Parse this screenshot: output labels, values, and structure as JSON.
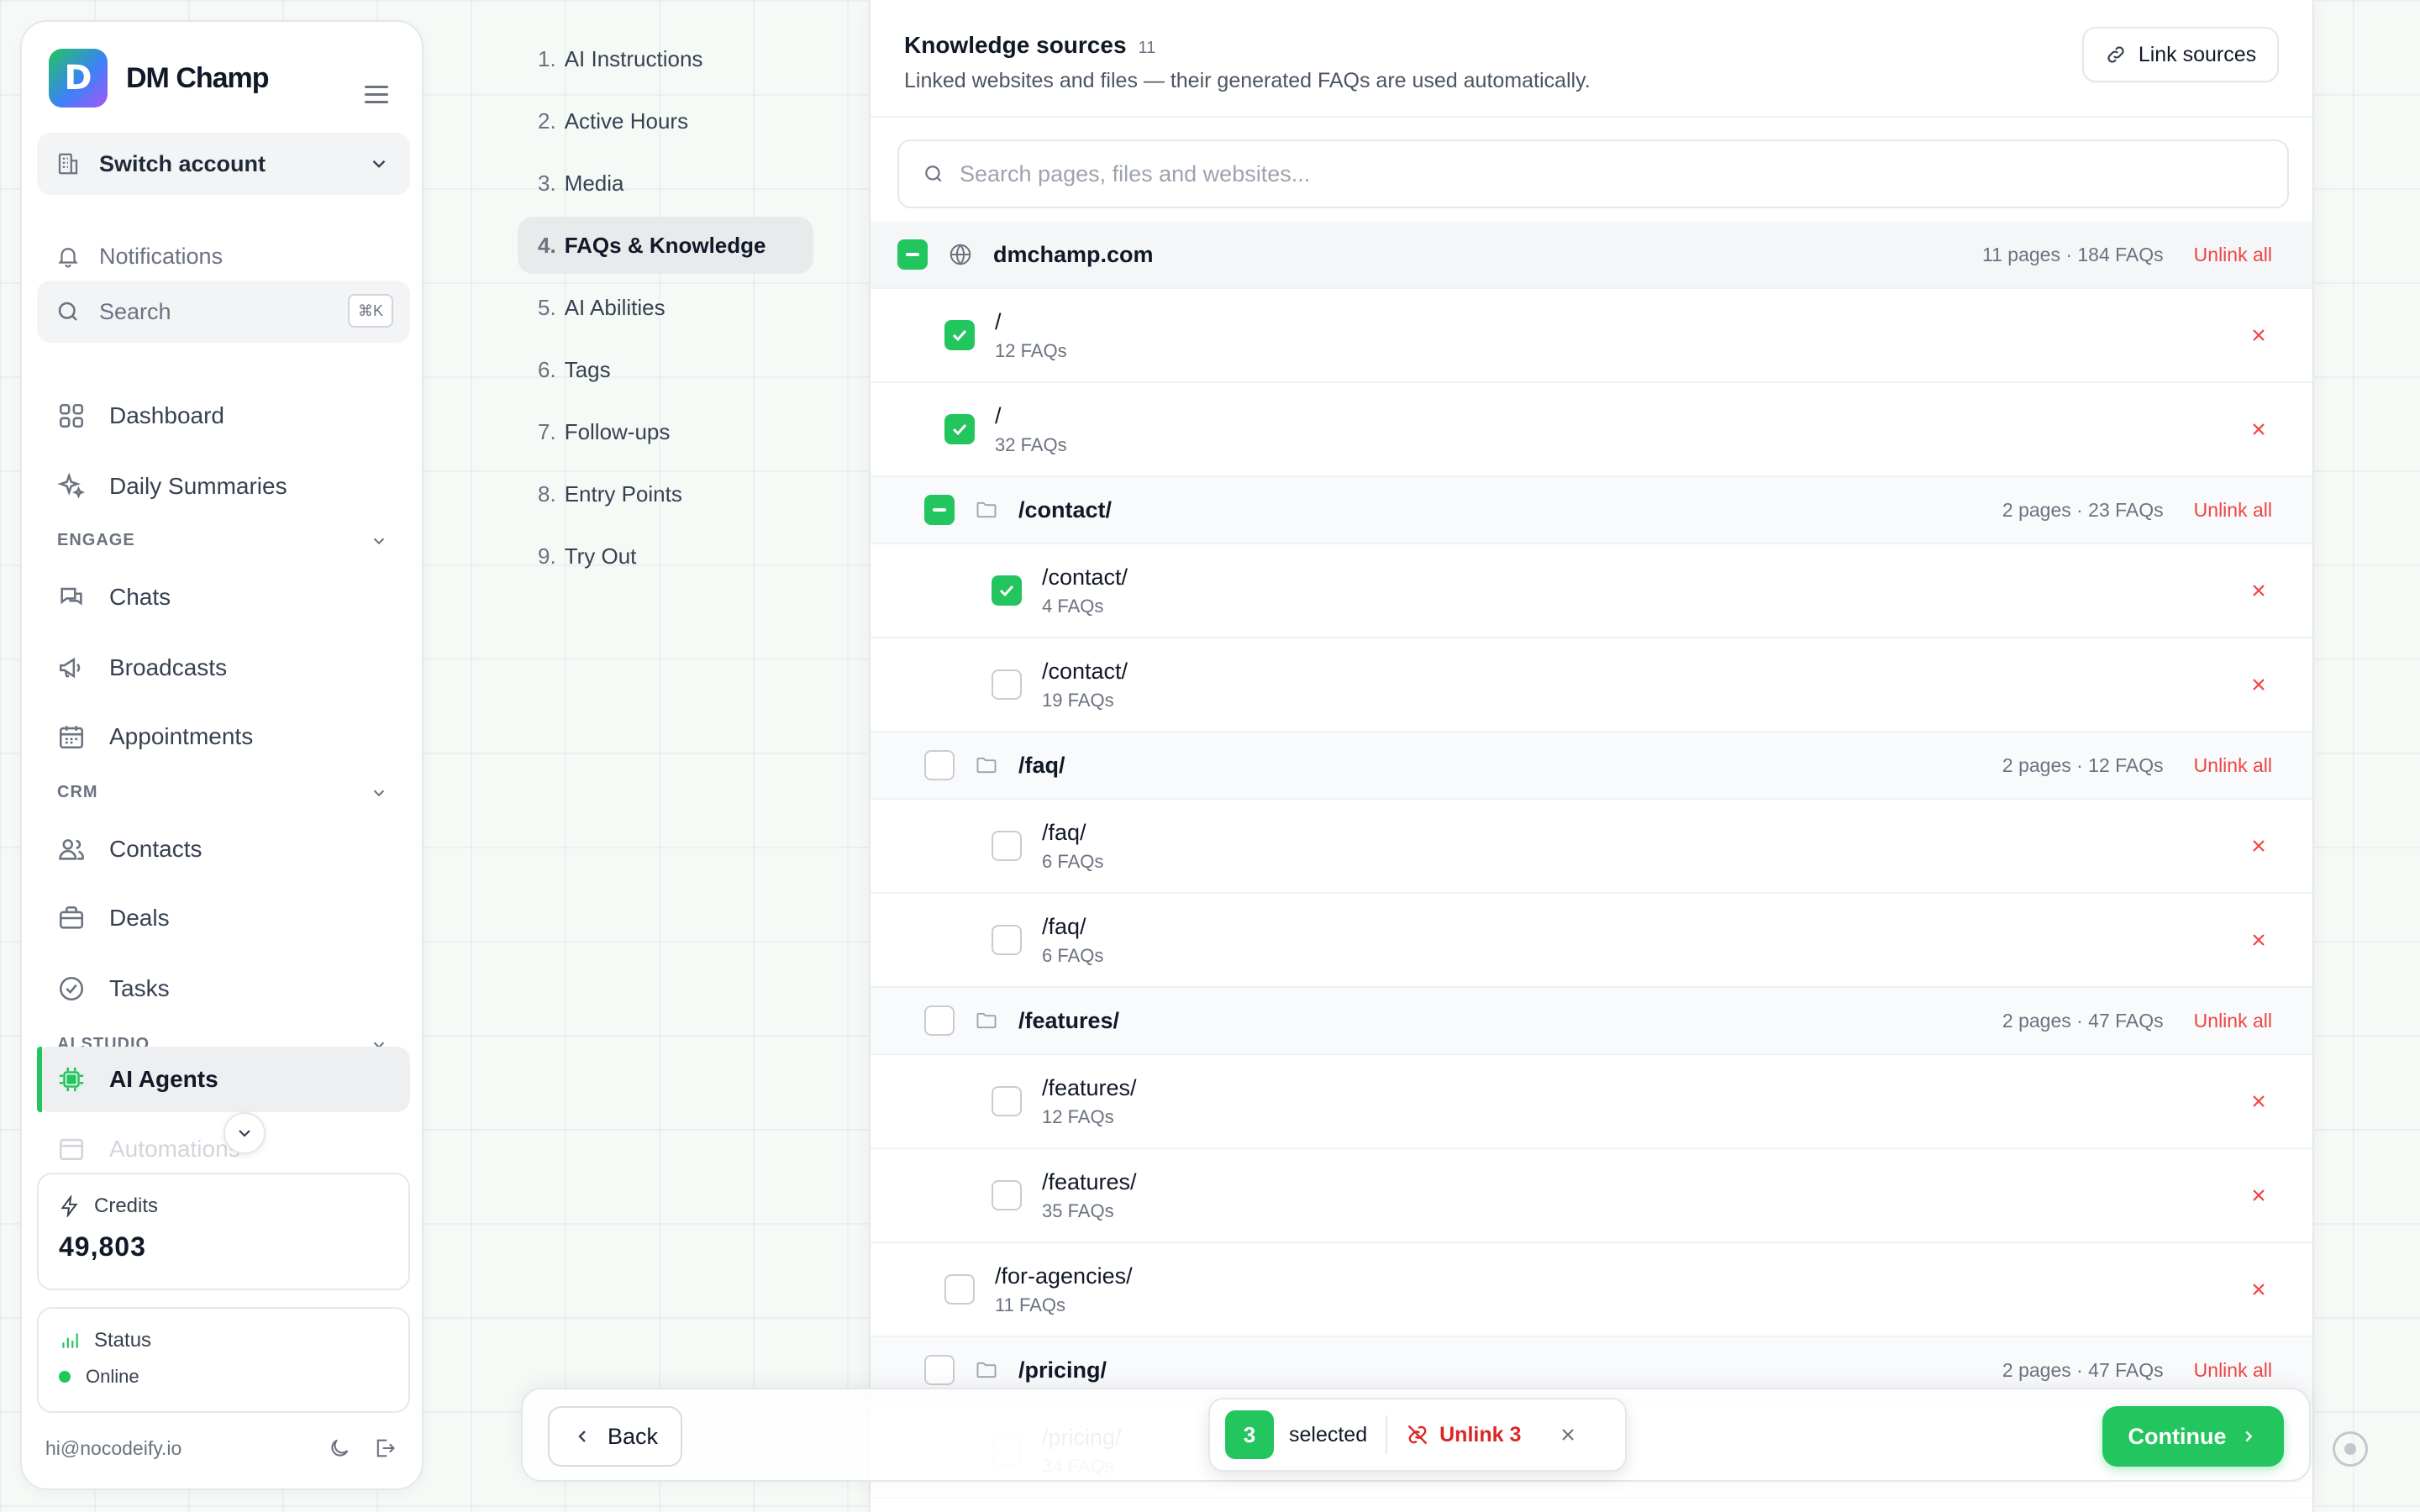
{
  "brand": {
    "name": "DM Champ",
    "logo_letter": "D"
  },
  "sidebar": {
    "switch_account": "Switch account",
    "notifications": "Notifications",
    "search_label": "Search",
    "search_kbd": "⌘K",
    "items_top": [
      {
        "label": "Dashboard",
        "icon": "grid-icon"
      },
      {
        "label": "Daily Summaries",
        "icon": "sparkles-icon"
      }
    ],
    "engage_header": "ENGAGE",
    "engage_items": [
      {
        "label": "Chats",
        "icon": "chat-icon"
      },
      {
        "label": "Broadcasts",
        "icon": "megaphone-icon"
      },
      {
        "label": "Appointments",
        "icon": "calendar-icon"
      }
    ],
    "crm_header": "CRM",
    "crm_items": [
      {
        "label": "Contacts",
        "icon": "users-icon"
      },
      {
        "label": "Deals",
        "icon": "briefcase-icon"
      },
      {
        "label": "Tasks",
        "icon": "check-circle-icon"
      }
    ],
    "ai_header": "AI STUDIO",
    "ai_items": [
      {
        "label": "AI Agents",
        "icon": "chip-icon",
        "active": true
      },
      {
        "label": "Automations",
        "icon": "calendar-icon"
      }
    ],
    "credits_label": "Credits",
    "credits_value": "49,803",
    "status_label": "Status",
    "status_value": "Online",
    "user_email": "hi@nocodeify.io"
  },
  "steps": [
    {
      "num": "1.",
      "label": "AI Instructions"
    },
    {
      "num": "2.",
      "label": "Active Hours"
    },
    {
      "num": "3.",
      "label": "Media"
    },
    {
      "num": "4.",
      "label": "FAQs & Knowledge",
      "active": true
    },
    {
      "num": "5.",
      "label": "AI Abilities"
    },
    {
      "num": "6.",
      "label": "Tags"
    },
    {
      "num": "7.",
      "label": "Follow-ups"
    },
    {
      "num": "8.",
      "label": "Entry Points"
    },
    {
      "num": "9.",
      "label": "Try Out"
    }
  ],
  "panel": {
    "title": "Knowledge sources",
    "count": "11",
    "subtitle": "Linked websites and files — their generated FAQs are used automatically.",
    "link_button": "Link sources",
    "search_placeholder": "Search pages, files and websites...",
    "unlink_all": "Unlink all"
  },
  "tree": {
    "root": {
      "name": "dmchamp.com",
      "meta": "11 pages · 184 FAQs",
      "state": "partial"
    },
    "rows": [
      {
        "type": "leaf",
        "level": 1,
        "path": "/",
        "faqs": "12 FAQs",
        "checked": true
      },
      {
        "type": "leaf",
        "level": 1,
        "path": "/",
        "faqs": "32 FAQs",
        "checked": true
      },
      {
        "type": "group",
        "name": "/contact/",
        "meta": "2 pages · 23 FAQs",
        "state": "partial"
      },
      {
        "type": "leaf",
        "level": 2,
        "path": "/contact/",
        "faqs": "4 FAQs",
        "checked": true
      },
      {
        "type": "leaf",
        "level": 2,
        "path": "/contact/",
        "faqs": "19 FAQs",
        "checked": false
      },
      {
        "type": "group",
        "name": "/faq/",
        "meta": "2 pages · 12 FAQs",
        "state": "none"
      },
      {
        "type": "leaf",
        "level": 2,
        "path": "/faq/",
        "faqs": "6 FAQs",
        "checked": false
      },
      {
        "type": "leaf",
        "level": 2,
        "path": "/faq/",
        "faqs": "6 FAQs",
        "checked": false
      },
      {
        "type": "group",
        "name": "/features/",
        "meta": "2 pages · 47 FAQs",
        "state": "none"
      },
      {
        "type": "leaf",
        "level": 2,
        "path": "/features/",
        "faqs": "12 FAQs",
        "checked": false
      },
      {
        "type": "leaf",
        "level": 2,
        "path": "/features/",
        "faqs": "35 FAQs",
        "checked": false
      },
      {
        "type": "leaf",
        "level": 1,
        "path": "/for-agencies/",
        "faqs": "11 FAQs",
        "checked": false
      },
      {
        "type": "group",
        "name": "/pricing/",
        "meta": "2 pages · 47 FAQs",
        "state": "none"
      },
      {
        "type": "leaf",
        "level": 2,
        "path": "/pricing/",
        "faqs": "34 FAQs",
        "checked": false,
        "faded": true
      }
    ]
  },
  "bottom": {
    "back": "Back",
    "continue": "Continue",
    "selected_count": "3",
    "selected_label": "selected",
    "unlink_label": "Unlink 3"
  },
  "colors": {
    "accent": "#22c55e",
    "danger": "#ef4444"
  }
}
